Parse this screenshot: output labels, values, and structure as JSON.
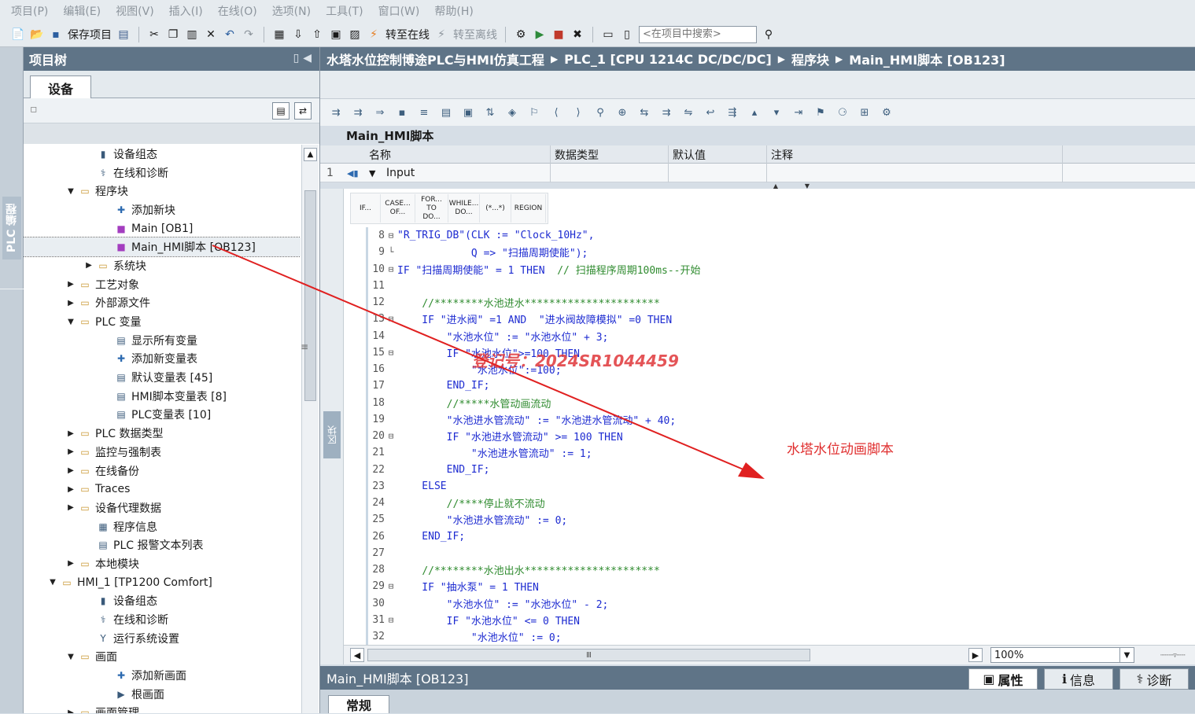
{
  "menu": [
    "项目(P)",
    "编辑(E)",
    "视图(V)",
    "插入(I)",
    "在线(O)",
    "选项(N)",
    "工具(T)",
    "窗口(W)",
    "帮助(H)"
  ],
  "toolbar": {
    "save_label": "保存项目",
    "go_online": "转至在线",
    "go_offline": "转至离线",
    "search_placeholder": "<在项目中搜索>"
  },
  "side_tab": "PLC 编程",
  "tree": {
    "title": "项目树",
    "tab": "设备",
    "items": [
      {
        "label": "设备组态",
        "indent": 3,
        "twisty": "",
        "icon": "device-config-icon",
        "glyph": "▮"
      },
      {
        "label": "在线和诊断",
        "indent": 3,
        "twisty": "",
        "icon": "diagnostics-icon",
        "glyph": "⚕"
      },
      {
        "label": "程序块",
        "indent": 2,
        "twisty": "▼",
        "icon": "folder-icon",
        "glyph": "▭"
      },
      {
        "label": "添加新块",
        "indent": 4,
        "twisty": "",
        "icon": "add-new-icon",
        "glyph": "✚"
      },
      {
        "label": "Main [OB1]",
        "indent": 4,
        "twisty": "",
        "icon": "block-icon",
        "glyph": "■"
      },
      {
        "label": "Main_HMI脚本 [OB123]",
        "indent": 4,
        "twisty": "",
        "icon": "block-icon",
        "glyph": "■",
        "selected": true
      },
      {
        "label": "系统块",
        "indent": 3,
        "twisty": "▶",
        "icon": "folder-icon",
        "glyph": "▭"
      },
      {
        "label": "工艺对象",
        "indent": 2,
        "twisty": "▶",
        "icon": "folder-icon",
        "glyph": "▭"
      },
      {
        "label": "外部源文件",
        "indent": 2,
        "twisty": "▶",
        "icon": "folder-icon",
        "glyph": "▭"
      },
      {
        "label": "PLC 变量",
        "indent": 2,
        "twisty": "▼",
        "icon": "folder-icon",
        "glyph": "▭"
      },
      {
        "label": "显示所有变量",
        "indent": 4,
        "twisty": "",
        "icon": "tag-table-icon",
        "glyph": "▤"
      },
      {
        "label": "添加新变量表",
        "indent": 4,
        "twisty": "",
        "icon": "add-new-icon",
        "glyph": "✚"
      },
      {
        "label": "默认变量表 [45]",
        "indent": 4,
        "twisty": "",
        "icon": "tag-table-icon",
        "glyph": "▤"
      },
      {
        "label": "HMI脚本变量表 [8]",
        "indent": 4,
        "twisty": "",
        "icon": "tag-table-icon",
        "glyph": "▤"
      },
      {
        "label": "PLC变量表 [10]",
        "indent": 4,
        "twisty": "",
        "icon": "tag-table-icon",
        "glyph": "▤"
      },
      {
        "label": "PLC 数据类型",
        "indent": 2,
        "twisty": "▶",
        "icon": "folder-icon",
        "glyph": "▭"
      },
      {
        "label": "监控与强制表",
        "indent": 2,
        "twisty": "▶",
        "icon": "folder-icon",
        "glyph": "▭"
      },
      {
        "label": "在线备份",
        "indent": 2,
        "twisty": "▶",
        "icon": "folder-icon",
        "glyph": "▭"
      },
      {
        "label": "Traces",
        "indent": 2,
        "twisty": "▶",
        "icon": "folder-icon",
        "glyph": "▭"
      },
      {
        "label": "设备代理数据",
        "indent": 2,
        "twisty": "▶",
        "icon": "folder-icon",
        "glyph": "▭"
      },
      {
        "label": "程序信息",
        "indent": 3,
        "twisty": "",
        "icon": "program-info-icon",
        "glyph": "▦"
      },
      {
        "label": "PLC 报警文本列表",
        "indent": 3,
        "twisty": "",
        "icon": "list-icon",
        "glyph": "▤"
      },
      {
        "label": "本地模块",
        "indent": 2,
        "twisty": "▶",
        "icon": "folder-icon",
        "glyph": "▭"
      },
      {
        "label": "HMI_1 [TP1200 Comfort]",
        "indent": 1,
        "twisty": "▼",
        "icon": "hmi-device-icon",
        "glyph": "▭"
      },
      {
        "label": "设备组态",
        "indent": 3,
        "twisty": "",
        "icon": "device-config-icon",
        "glyph": "▮"
      },
      {
        "label": "在线和诊断",
        "indent": 3,
        "twisty": "",
        "icon": "diagnostics-icon",
        "glyph": "⚕"
      },
      {
        "label": "运行系统设置",
        "indent": 3,
        "twisty": "",
        "icon": "runtime-settings-icon",
        "glyph": "Y"
      },
      {
        "label": "画面",
        "indent": 2,
        "twisty": "▼",
        "icon": "folder-icon",
        "glyph": "▭"
      },
      {
        "label": "添加新画面",
        "indent": 4,
        "twisty": "",
        "icon": "add-new-icon",
        "glyph": "✚"
      },
      {
        "label": "根画面",
        "indent": 4,
        "twisty": "",
        "icon": "screen-icon",
        "glyph": "▶"
      },
      {
        "label": "画面管理",
        "indent": 2,
        "twisty": "▶",
        "icon": "folder-icon",
        "glyph": "▭"
      }
    ]
  },
  "breadcrumb": [
    "水塔水位控制博途PLC与HMI仿真工程",
    "PLC_1 [CPU 1214C DC/DC/DC]",
    "程序块",
    "Main_HMI脚本 [OB123]"
  ],
  "block_name": "Main_HMI脚本",
  "interface": {
    "columns": [
      "名称",
      "数据类型",
      "默认值",
      "注释"
    ],
    "row_num": "1",
    "row_name": "Input"
  },
  "snippets": [
    "IF...",
    "CASE... OF...",
    "FOR... TO DO...",
    "WHILE... DO...",
    "(*...*)",
    "REGION"
  ],
  "code": [
    {
      "n": "8",
      "f": "⊟",
      "t": "\"R_TRIG_DB\"(CLK := \"Clock_10Hz\",",
      "c": ""
    },
    {
      "n": "9",
      "f": "└",
      "t": "            Q => \"扫描周期使能\");",
      "c": ""
    },
    {
      "n": "10",
      "f": "⊟",
      "t": "IF \"扫描周期使能\" = 1 THEN  ",
      "c": "// 扫描程序周期100ms--开始"
    },
    {
      "n": "11",
      "f": "",
      "t": "",
      "c": ""
    },
    {
      "n": "12",
      "f": "",
      "t": "    ",
      "c": "//********水池进水**********************"
    },
    {
      "n": "13",
      "f": "⊟",
      "t": "    IF \"进水阀\" =1 AND  \"进水阀故障模拟\" =0 THEN",
      "c": ""
    },
    {
      "n": "14",
      "f": "",
      "t": "        \"水池水位\" := \"水池水位\" + 3;",
      "c": ""
    },
    {
      "n": "15",
      "f": "⊟",
      "t": "        IF \"水池水位\">=100 THEN",
      "c": ""
    },
    {
      "n": "16",
      "f": "",
      "t": "            \"水池水位\":=100;",
      "c": ""
    },
    {
      "n": "17",
      "f": "",
      "t": "        END_IF;",
      "c": ""
    },
    {
      "n": "18",
      "f": "",
      "t": "        ",
      "c": "//*****水管动画流动"
    },
    {
      "n": "19",
      "f": "",
      "t": "        \"水池进水管流动\" := \"水池进水管流动\" + 40;",
      "c": ""
    },
    {
      "n": "20",
      "f": "⊟",
      "t": "        IF \"水池进水管流动\" >= 100 THEN",
      "c": ""
    },
    {
      "n": "21",
      "f": "",
      "t": "            \"水池进水管流动\" := 1;",
      "c": ""
    },
    {
      "n": "22",
      "f": "",
      "t": "        END_IF;",
      "c": ""
    },
    {
      "n": "23",
      "f": "",
      "t": "    ELSE",
      "c": ""
    },
    {
      "n": "24",
      "f": "",
      "t": "        ",
      "c": "//****停止就不流动"
    },
    {
      "n": "25",
      "f": "",
      "t": "        \"水池进水管流动\" := 0;",
      "c": ""
    },
    {
      "n": "26",
      "f": "",
      "t": "    END_IF;",
      "c": ""
    },
    {
      "n": "27",
      "f": "",
      "t": "",
      "c": ""
    },
    {
      "n": "28",
      "f": "",
      "t": "    ",
      "c": "//********水池出水**********************"
    },
    {
      "n": "29",
      "f": "⊟",
      "t": "    IF \"抽水泵\" = 1 THEN",
      "c": ""
    },
    {
      "n": "30",
      "f": "",
      "t": "        \"水池水位\" := \"水池水位\" - 2;",
      "c": ""
    },
    {
      "n": "31",
      "f": "⊟",
      "t": "        IF \"水池水位\" <= 0 THEN",
      "c": ""
    },
    {
      "n": "32",
      "f": "",
      "t": "            \"水池水位\" := 0;",
      "c": ""
    }
  ],
  "zoom": "100%",
  "inspector": {
    "title": "Main_HMI脚本 [OB123]",
    "tabs": [
      "属性",
      "信息",
      "诊断"
    ],
    "sub_tab": "常规"
  },
  "annotation": "水塔水位动画脚本",
  "watermark": "登记号：2024SR1044459",
  "left_dock_label": "区块",
  "colors": {
    "header": "#5f7487",
    "annotation": "#e03030",
    "code_blue": "#1d2bd1",
    "comment_green": "#2f8b2f"
  }
}
